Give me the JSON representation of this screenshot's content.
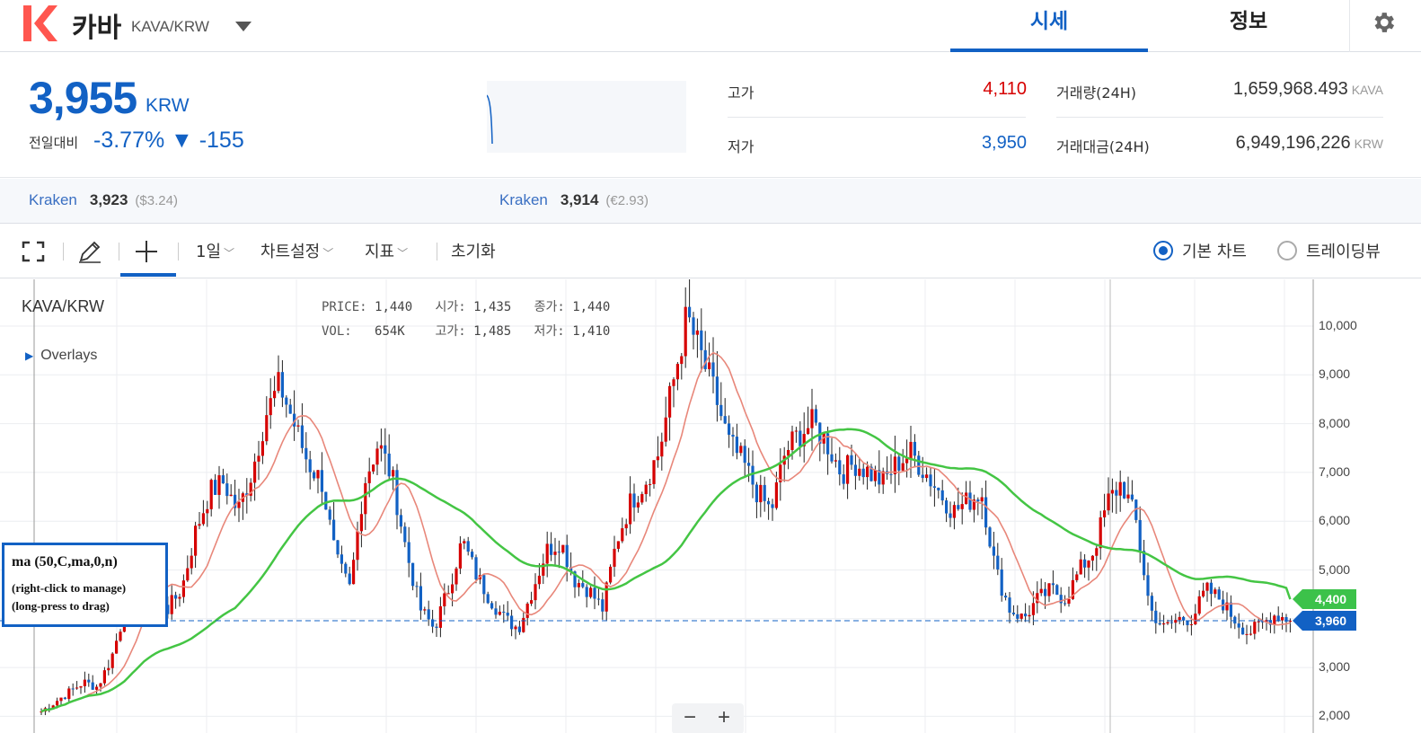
{
  "header": {
    "logo_icon": "kava-k-logo",
    "coin_name": "카바",
    "pair": "KAVA/KRW",
    "tabs": [
      {
        "label": "시세",
        "active": true
      },
      {
        "label": "정보",
        "active": false
      }
    ],
    "settings_icon": "gear-icon"
  },
  "summary": {
    "price": "3,955",
    "unit": "KRW",
    "change_label": "전일대비",
    "change_rate": "-3.77%",
    "change_amount": "▼ -155",
    "high_label": "고가",
    "high": "4,110",
    "low_label": "저가",
    "low": "3,950",
    "volume_label": "거래량(24H)",
    "volume": "1,659,968.493",
    "volume_unit": "KAVA",
    "value_label": "거래대금(24H)",
    "value": "6,949,196,226",
    "value_unit": "KRW",
    "colors": {
      "up": "#d60000",
      "down": "#1261c4"
    }
  },
  "exchanges": [
    {
      "name": "Kraken",
      "price": "3,923",
      "sub": "($3.24)"
    },
    {
      "name": "Kraken",
      "price": "3,914",
      "sub": "(€2.93)"
    }
  ],
  "toolbar": {
    "fullscreen_icon": "fullscreen-icon",
    "pencil_icon": "pencil-icon",
    "crosshair_icon": "crosshair-icon",
    "interval": "1일",
    "chart_settings": "차트설정",
    "indicators": "지표",
    "reset": "초기화",
    "basic_chart": "기본 차트",
    "tradingview": "트레이딩뷰"
  },
  "chart": {
    "pair_label": "KAVA/KRW",
    "overlays": "Overlays",
    "ohlc": {
      "price_k": "PRICE:",
      "price": "1,440",
      "open_k": "시가:",
      "open": "1,435",
      "close_k": "종가:",
      "close": "1,440",
      "vol_k": "VOL:",
      "vol": "654K",
      "high_k": "고가:",
      "high": "1,485",
      "low_k": "저가:",
      "low": "1,410"
    },
    "ma_box": {
      "title": "ma (50,C,ma,0,n)",
      "help1": "(right-click to manage)",
      "help2": "(long-press to drag)"
    },
    "tag_ma": "4,400",
    "tag_last": "3,960",
    "zoom_minus": "−",
    "zoom_plus": "+",
    "colors": {
      "up": "#d60000",
      "down": "#1261c4",
      "ma_long": "#44c544",
      "ma_short": "#e8877a"
    }
  },
  "chart_data": {
    "type": "candlestick",
    "y_ticks": [
      "10,000",
      "9,000",
      "8,000",
      "7,000",
      "6,000",
      "5,000",
      "3,000",
      "2,000"
    ],
    "ylim": [
      2000,
      10000
    ],
    "last_price": 3960,
    "ma_value": 4400,
    "series": [
      {
        "name": "ma (50,C,ma,0,n)"
      }
    ],
    "approx_close": [
      2100,
      2300,
      2500,
      2700,
      2600,
      3200,
      4200,
      5200,
      4800,
      4200,
      4600,
      5800,
      6600,
      6800,
      6200,
      7000,
      8200,
      8800,
      8000,
      7200,
      6800,
      5200,
      4600,
      6800,
      7600,
      6900,
      5400,
      4200,
      3800,
      4600,
      5600,
      4900,
      4400,
      4000,
      3800,
      4600,
      5400,
      5600,
      4800,
      4600,
      4200,
      5600,
      6400,
      6800,
      7400,
      8800,
      10200,
      9400,
      8600,
      7600,
      7200,
      6600,
      6200,
      7400,
      7800,
      8000,
      7600,
      7000,
      7200,
      7000,
      6800,
      7200,
      7400,
      7000,
      6600,
      6200,
      6400,
      6600,
      5000,
      4200,
      4000,
      4400,
      4600,
      4400,
      5000,
      5400,
      6400,
      6800,
      6000,
      4200,
      3800,
      4000,
      4000,
      4600,
      4400,
      4000,
      3700,
      3900,
      4100,
      3960
    ]
  }
}
